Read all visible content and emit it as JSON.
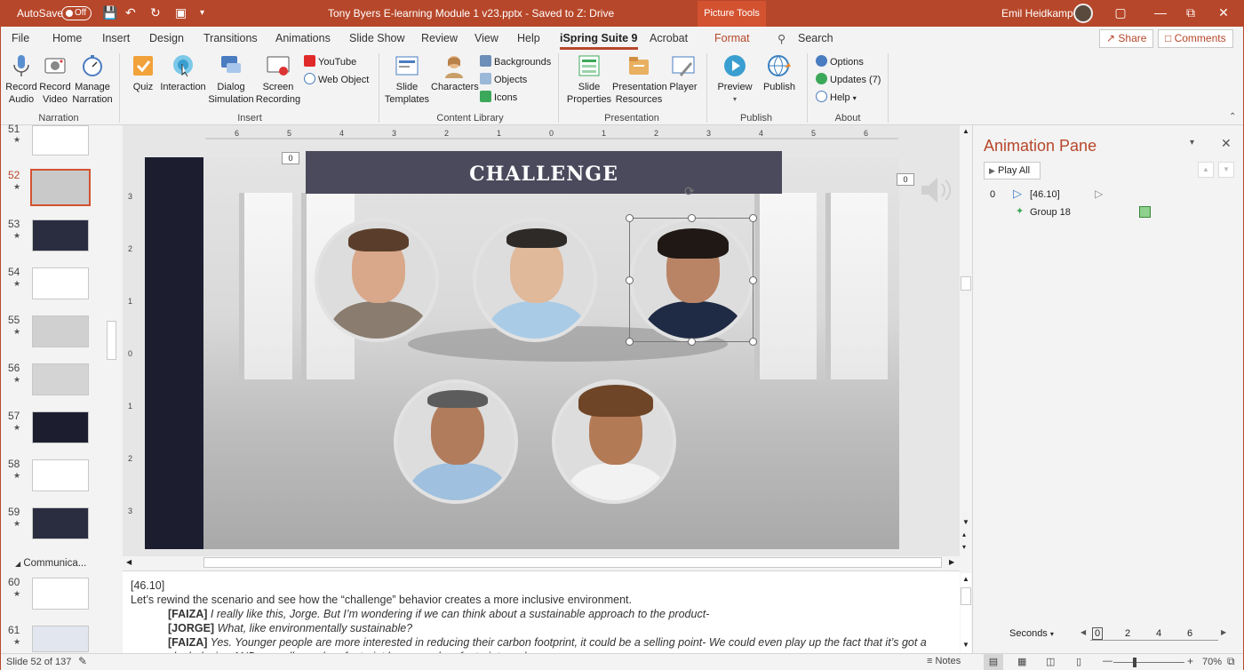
{
  "titlebar": {
    "autosave_label": "AutoSave",
    "autosave_state": "Off",
    "document_title": "Tony Byers E-learning Module 1 v23.pptx  -  Saved to Z: Drive",
    "context_tab": "Picture Tools",
    "user_name": "Emil Heidkamp",
    "accent": "#b7472a"
  },
  "menu": {
    "tabs": [
      "File",
      "Home",
      "Insert",
      "Design",
      "Transitions",
      "Animations",
      "Slide Show",
      "Review",
      "View",
      "Help",
      "iSpring Suite 9",
      "Acrobat",
      "Format"
    ],
    "active_tab": "iSpring Suite 9",
    "search_label": "Search",
    "share_label": "Share",
    "comments_label": "Comments"
  },
  "ribbon": {
    "narration": {
      "label": "Narration",
      "buttons": [
        "Record Audio",
        "Record Video",
        "Manage Narration"
      ]
    },
    "insert": {
      "label": "Insert",
      "buttons": [
        "Quiz",
        "Interaction",
        "Dialog Simulation",
        "Screen Recording"
      ],
      "small": [
        "YouTube",
        "Web Object"
      ]
    },
    "content_library": {
      "label": "Content Library",
      "buttons": [
        "Slide Templates",
        "Characters"
      ],
      "small": [
        "Backgrounds",
        "Objects",
        "Icons"
      ]
    },
    "presentation": {
      "label": "Presentation",
      "buttons": [
        "Slide Properties",
        "Presentation Resources",
        "Player"
      ]
    },
    "publish": {
      "label": "Publish",
      "buttons": [
        "Preview",
        "Publish"
      ]
    },
    "about": {
      "label": "About",
      "small": [
        "Options",
        "Updates (7)",
        "Help"
      ]
    }
  },
  "thumbnails": {
    "slides": [
      "51",
      "52",
      "53",
      "54",
      "55",
      "56",
      "57",
      "58",
      "59"
    ],
    "selected": "52",
    "section_name": "Communica...",
    "after_section": [
      "60",
      "61"
    ]
  },
  "slide": {
    "banner_text": "CHALLENGE",
    "timing_left": "0",
    "timing_right": "0"
  },
  "notes": {
    "timestamp": "[46.10]",
    "intro": "Let’s rewind the scenario and see how the “challenge” behavior creates a more inclusive environment.",
    "lines": [
      {
        "speaker": "[FAIZA]",
        "text": " I really like this, Jorge.  But I’m wondering if we can think about a sustainable approach to the product-"
      },
      {
        "speaker": "[JORGE]",
        "text": " What, like environmentally sustainable?"
      },
      {
        "speaker": "[FAIZA]",
        "text": " Yes. Younger people are more interested in reducing their carbon footprint, it could be a selling point-  We could even play up the fact that it’s got a sleek design AND a smaller carbon footprint because shoe   footprint   you know"
      }
    ]
  },
  "animation_pane": {
    "title": "Animation Pane",
    "play_all": "Play All",
    "items": [
      {
        "index": "0",
        "label": "[46.10]"
      },
      {
        "index": "",
        "label": "Group 18"
      }
    ],
    "timeline_unit": "Seconds",
    "timeline_ticks": [
      "0",
      "2",
      "4",
      "6"
    ]
  },
  "status": {
    "slide_info": "Slide 52 of 137",
    "notes_label": "Notes",
    "zoom": "70%"
  },
  "ruler": {
    "h_ticks": [
      "6",
      "5",
      "4",
      "3",
      "2",
      "1",
      "0",
      "1",
      "2",
      "3",
      "4",
      "5",
      "6"
    ],
    "v_ticks": [
      "3",
      "2",
      "1",
      "0",
      "1",
      "2",
      "3"
    ]
  }
}
